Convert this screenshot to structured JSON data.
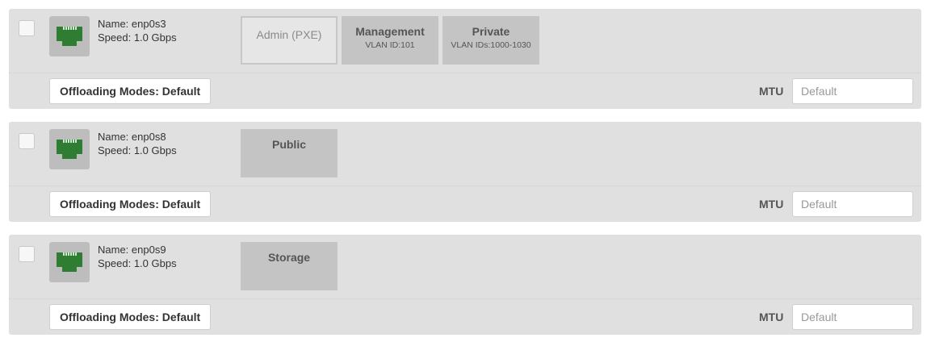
{
  "interfaces": [
    {
      "name": "Name: enp0s3",
      "speed": "Speed: 1.0 Gbps",
      "networks": [
        {
          "name": "Admin (PXE)",
          "vlan": "",
          "style": "admin"
        },
        {
          "name": "Management",
          "vlan": "VLAN ID:101",
          "style": "normal"
        },
        {
          "name": "Private",
          "vlan": "VLAN IDs:1000-1030",
          "style": "normal"
        }
      ],
      "offloading_label": "Offloading Modes: Default",
      "mtu_label": "MTU",
      "mtu_placeholder": "Default"
    },
    {
      "name": "Name: enp0s8",
      "speed": "Speed: 1.0 Gbps",
      "networks": [
        {
          "name": "Public",
          "vlan": "",
          "style": "normal"
        }
      ],
      "offloading_label": "Offloading Modes: Default",
      "mtu_label": "MTU",
      "mtu_placeholder": "Default"
    },
    {
      "name": "Name: enp0s9",
      "speed": "Speed: 1.0 Gbps",
      "networks": [
        {
          "name": "Storage",
          "vlan": "",
          "style": "normal"
        }
      ],
      "offloading_label": "Offloading Modes: Default",
      "mtu_label": "MTU",
      "mtu_placeholder": "Default"
    }
  ],
  "colors": {
    "port_icon": "#2e7d32",
    "panel_bg": "#e0e0e0",
    "network_box": "#c4c4c4"
  },
  "icons": {
    "port": "ethernet-port-icon"
  }
}
